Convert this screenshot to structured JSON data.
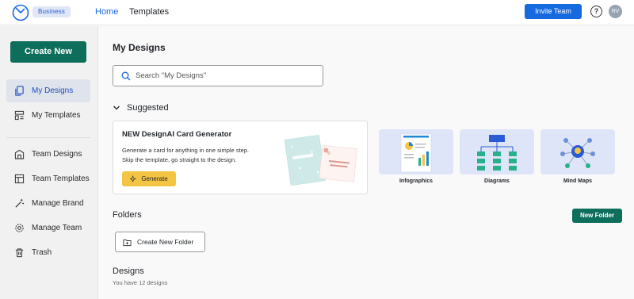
{
  "header": {
    "badge": "Business",
    "nav": {
      "home": "Home",
      "templates": "Templates"
    },
    "invite_label": "Invite Team",
    "help_glyph": "?",
    "avatar_initials": "RV",
    "colors": {
      "accent": "#1769e0",
      "badge_bg": "#dfe6f6"
    }
  },
  "sidebar": {
    "create_new": "Create New",
    "items": [
      {
        "label": "My Designs",
        "icon": "designs-icon",
        "active": true
      },
      {
        "label": "My Templates",
        "icon": "templates-icon"
      },
      {
        "label": "Team Designs",
        "icon": "team-designs-icon"
      },
      {
        "label": "Team Templates",
        "icon": "team-templates-icon"
      },
      {
        "label": "Manage Brand",
        "icon": "magic-wand-icon"
      },
      {
        "label": "Manage Team",
        "icon": "gear-icon"
      },
      {
        "label": "Trash",
        "icon": "trash-icon"
      }
    ],
    "colors": {
      "primary": "#0e6e5c"
    }
  },
  "main": {
    "title": "My Designs",
    "search": {
      "placeholder": "Search \"My Designs\""
    },
    "suggested": {
      "label": "Suggested",
      "card": {
        "title": "NEW DesignAI Card Generator",
        "desc1": "Generate a card for anything in one simple step.",
        "desc2": "Skip the template, go straight to the design.",
        "button": "Generate"
      },
      "tiles": [
        {
          "label": "Infographics",
          "icon": "infographic-icon"
        },
        {
          "label": "Diagrams",
          "icon": "diagram-icon"
        },
        {
          "label": "Mind Maps",
          "icon": "mind-map-icon"
        }
      ]
    },
    "folders": {
      "title": "Folders",
      "new_folder": "New Folder",
      "create_folder": "Create New Folder"
    },
    "designs": {
      "title": "Designs",
      "subtitle": "You have 12 designs"
    }
  }
}
